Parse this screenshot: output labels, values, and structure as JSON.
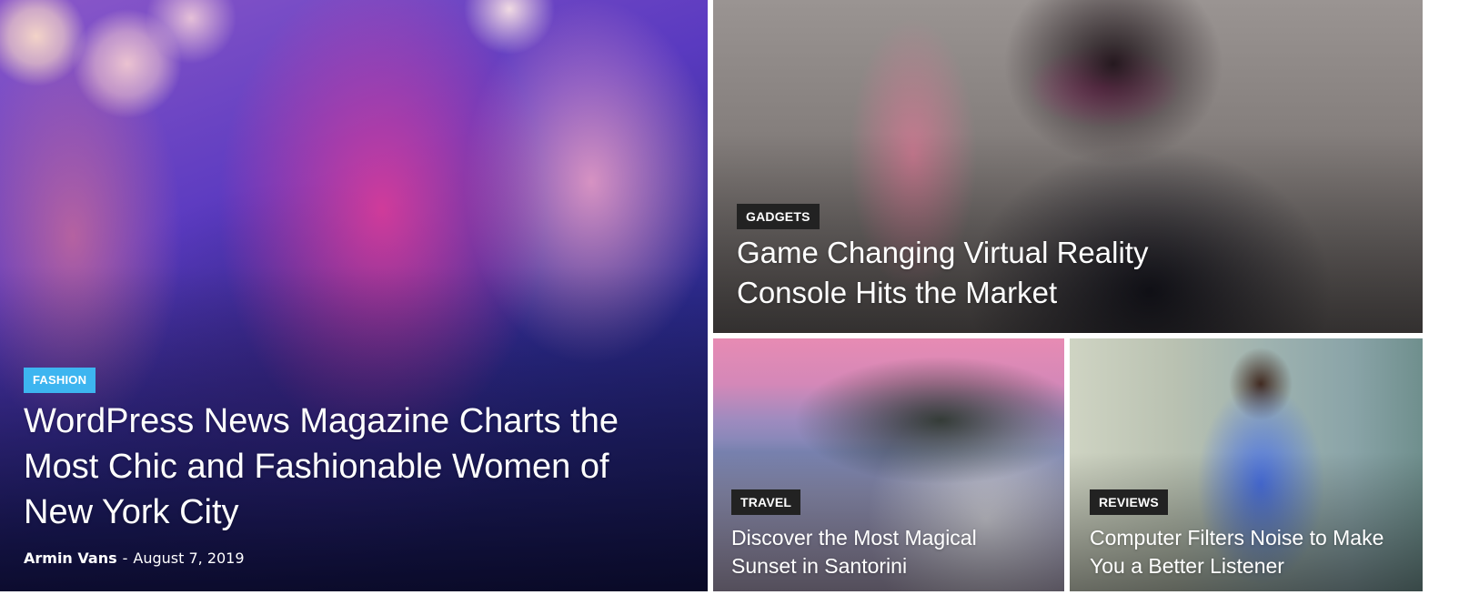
{
  "featured": {
    "category": "FASHION",
    "title": "WordPress News Magazine Charts the Most Chic and Fashionable Women of New York City",
    "author": "Armin Vans",
    "separator": "-",
    "date": "August 7, 2019"
  },
  "top_right": {
    "category": "GADGETS",
    "title": "Game Changing Virtual Reality Console Hits the Market"
  },
  "bottom_left": {
    "category": "TRAVEL",
    "title": "Discover the Most Magical Sunset in Santorini"
  },
  "bottom_right": {
    "category": "REVIEWS",
    "title": "Computer Filters Noise to Make You a Better Listener"
  },
  "colors": {
    "fashion_badge": "#3db5f0",
    "dark_badge": "#222222"
  }
}
